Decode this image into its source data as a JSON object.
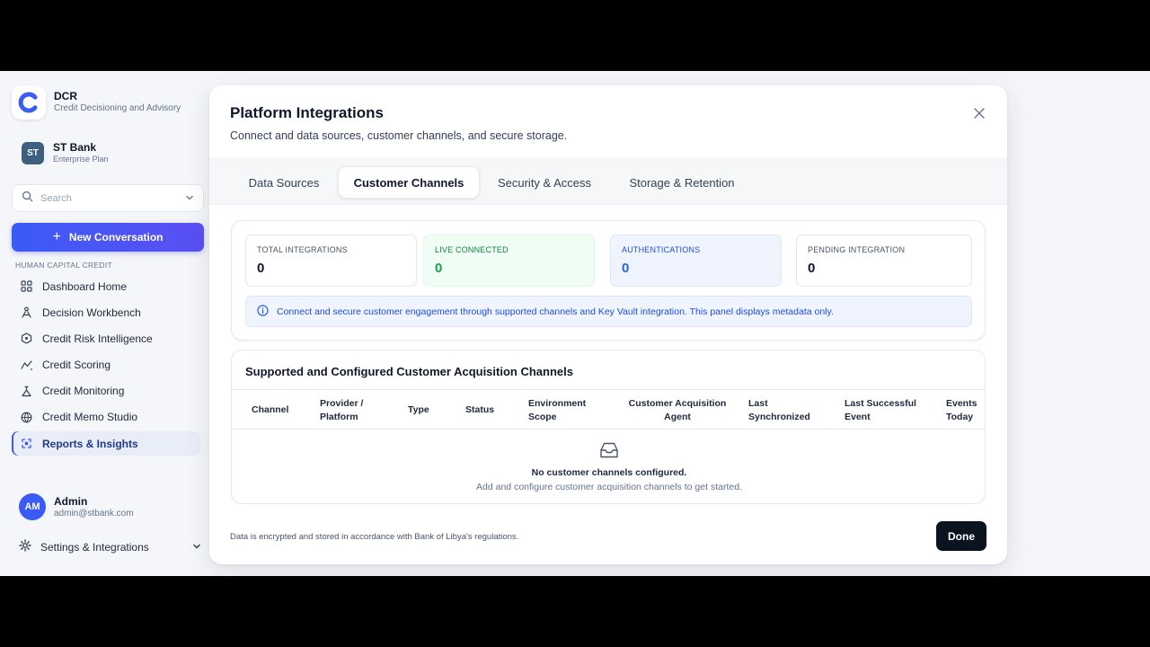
{
  "brand": {
    "name": "DCR",
    "subtitle": "Credit Decisioning and Advisory"
  },
  "org": {
    "initials": "ST",
    "name": "ST Bank",
    "plan": "Enterprise Plan"
  },
  "sidebar": {
    "search_label": "Search",
    "new_conversation": "New Conversation",
    "section_label": "HUMAN CAPITAL CREDIT",
    "items": [
      {
        "label": "Dashboard Home",
        "icon": "grid-icon"
      },
      {
        "label": "Decision Workbench",
        "icon": "workbench-icon"
      },
      {
        "label": "Credit Risk Intelligence",
        "icon": "risk-icon"
      },
      {
        "label": "Credit Scoring",
        "icon": "scoring-icon"
      },
      {
        "label": "Credit Monitoring",
        "icon": "monitoring-icon"
      },
      {
        "label": "Credit Memo Studio",
        "icon": "memo-icon"
      },
      {
        "label": "Reports & Insights",
        "icon": "reports-icon",
        "active": true
      }
    ],
    "user": {
      "initials": "AM",
      "name": "Admin",
      "email": "admin@stbank.com"
    },
    "settings_label": "Settings & Integrations"
  },
  "modal": {
    "title": "Platform Integrations",
    "subtitle": "Connect and data sources, customer channels, and secure storage.",
    "tabs": [
      {
        "label": "Data Sources"
      },
      {
        "label": "Customer Channels",
        "active": true
      },
      {
        "label": "Security & Access"
      },
      {
        "label": "Storage & Retention"
      }
    ],
    "stats": [
      {
        "label": "TOTAL INTEGRATIONS",
        "value": "0"
      },
      {
        "label": "LIVE CONNECTED",
        "value": "0"
      },
      {
        "label": "AUTHENTICATIONS",
        "value": "0"
      },
      {
        "label": "PENDING INTEGRATION",
        "value": "0"
      }
    ],
    "info": "Connect and secure customer engagement through supported channels and Key Vault integration. This panel displays metadata only.",
    "table": {
      "title": "Supported and Configured Customer Acquisition Channels",
      "headers": [
        "Channel",
        "Provider / Platform",
        "Type",
        "Status",
        "Environment Scope",
        "Customer Acquisition Agent",
        "Last Synchronized",
        "Last Successful Event",
        "Events Today"
      ],
      "empty_title": "No customer channels configured.",
      "empty_subtitle": "Add and configure customer acquisition channels to get started."
    },
    "footer_note": "Data is encrypted and stored in accordance with Bank of Libya's regulations.",
    "done_label": "Done"
  },
  "colors": {
    "accent": "#3b5bf6",
    "live_green": "#16a34a",
    "auth_blue": "#2563eb",
    "done_button": "#0b1220"
  }
}
